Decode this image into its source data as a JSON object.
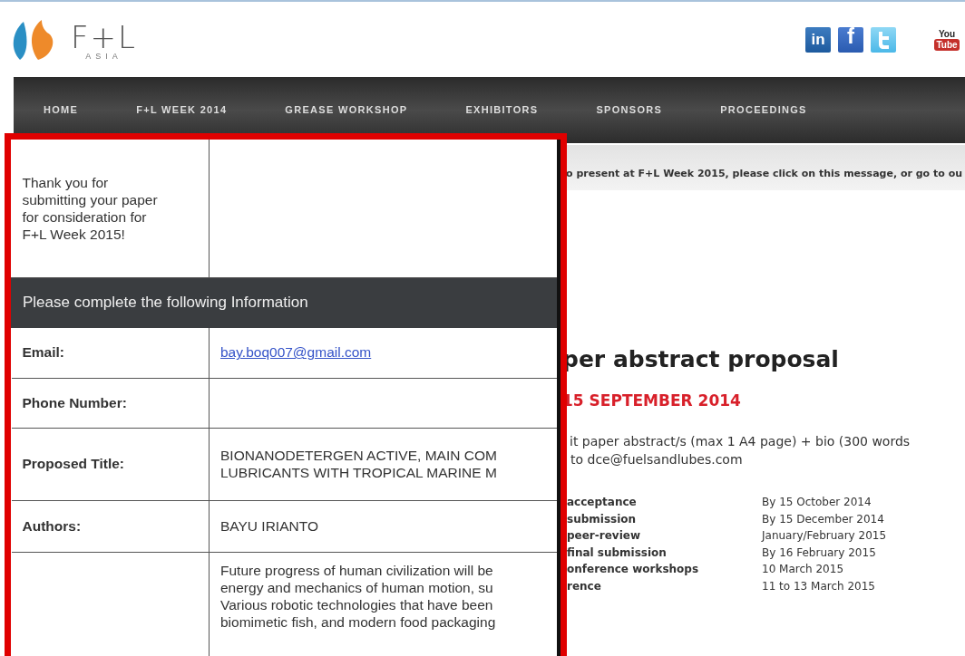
{
  "logo": {
    "text": "F+L",
    "subtext": "ASIA"
  },
  "social": [
    {
      "kind": "linkedin",
      "label": "in"
    },
    {
      "kind": "facebook",
      "label": "f"
    },
    {
      "kind": "twitter"
    },
    {
      "kind": "youtube",
      "label": "You",
      "sublabel": "Tube"
    }
  ],
  "nav": [
    {
      "label": "HOME"
    },
    {
      "label": "F+L WEEK 2014"
    },
    {
      "label": "GREASE WORKSHOP"
    },
    {
      "label": "EXHIBITORS"
    },
    {
      "label": "SPONSORS"
    },
    {
      "label": "PROCEEDINGS"
    }
  ],
  "notice": "o present at F+L Week 2015, please click on this message, or go to ou",
  "heading": "per abstract proposal",
  "deadline": "15 SEPTEMBER 2014",
  "instructions": [
    "it paper abstract/s (max 1 A4 page) + bio (300 words",
    "to dce@fuelsandlubes.com"
  ],
  "schedule": [
    {
      "label": "acceptance",
      "date": "By 15 October 2014"
    },
    {
      "label": "submission",
      "date": "By 15 December 2014"
    },
    {
      "label": "peer-review",
      "date": "January/February 2015"
    },
    {
      "label": "final submission",
      "date": "By 16 February 2015"
    },
    {
      "label": "onference workshops",
      "date": "10 March 2015"
    },
    {
      "label": "rence",
      "date": "11 to 13 March 2015"
    }
  ],
  "dialog": {
    "message": "Thank you for submitting your paper for consideration for F+L Week 2015!",
    "section_title": "Please complete the following Information",
    "fields": [
      {
        "label": "Email:",
        "kind": "link",
        "value": [
          "bay.boq007@gmail.com"
        ]
      },
      {
        "label": "Phone Number:"
      },
      {
        "label": "Proposed Title:",
        "kind": "text",
        "value": [
          "BIONANODETERGEN ACTIVE, MAIN COM",
          "LUBRICANTS WITH TROPICAL MARINE M"
        ]
      },
      {
        "label": "Authors:",
        "kind": "text",
        "value": [
          "BAYU IRIANTO"
        ]
      },
      {
        "kind": "text",
        "value": [
          "Future progress of human civilization will be",
          "energy and mechanics of human motion, su",
          "Various robotic technologies that have been",
          "biomimetic fish, and modern food packaging"
        ]
      }
    ]
  }
}
